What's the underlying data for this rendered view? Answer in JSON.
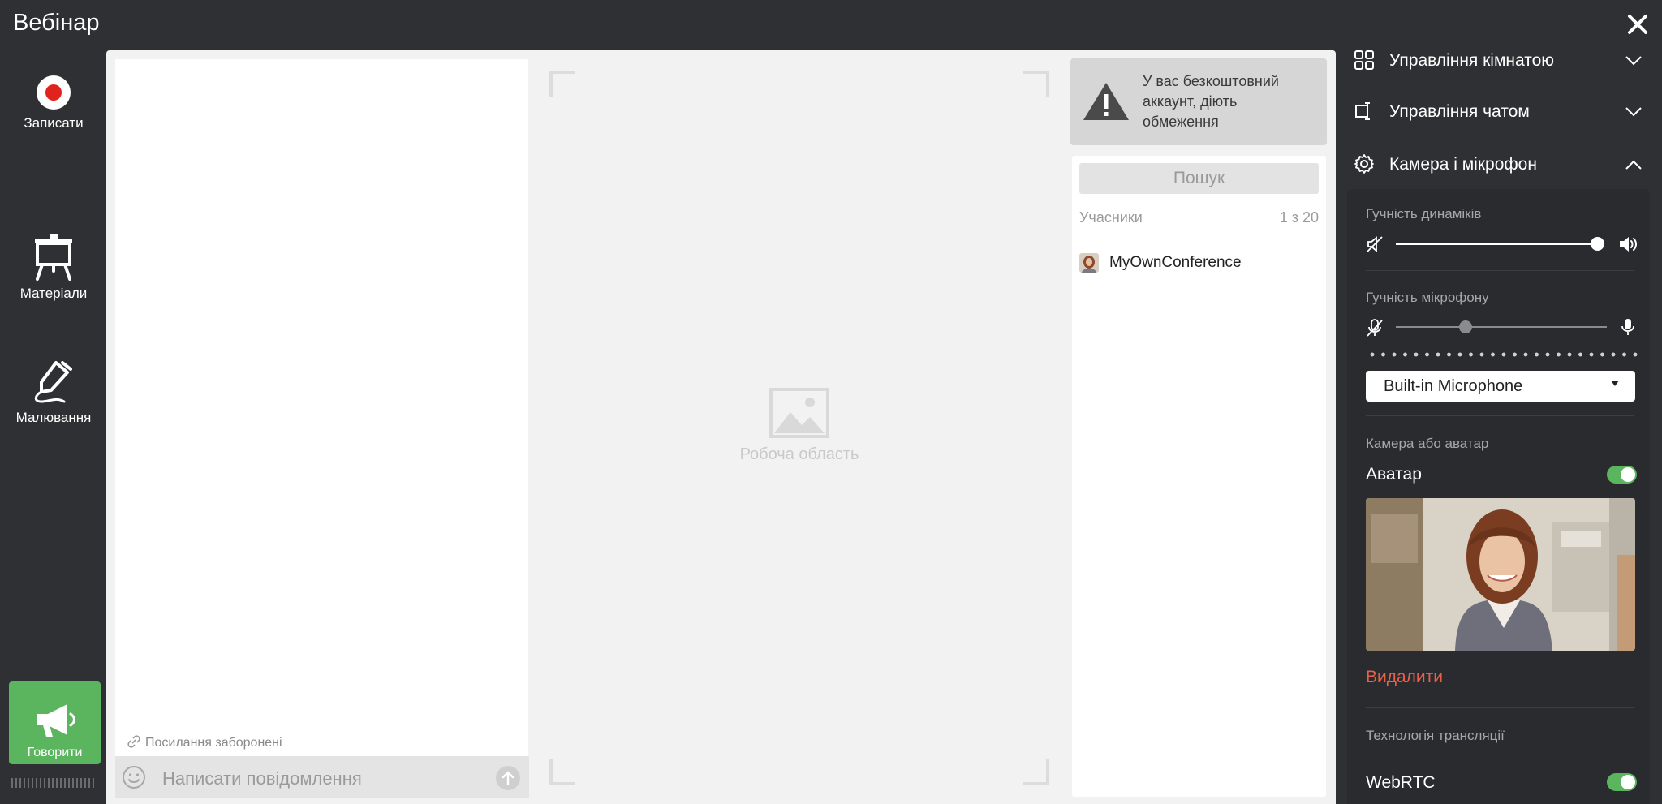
{
  "window": {
    "title": "Вебінар"
  },
  "sidebar": {
    "record_label": "Записати",
    "materials_label": "Матеріали",
    "drawing_label": "Малювання",
    "speak_label": "Говорити"
  },
  "chat": {
    "links_note": "Посилання заборонені",
    "input_placeholder": "Написати повідомлення"
  },
  "workspace": {
    "label": "Робоча область"
  },
  "warning": {
    "text": "У вас безкоштовний аккаунт, діють обмеження"
  },
  "participants": {
    "search_label": "Пошук",
    "header_label": "Учасники",
    "count": "1 з 20",
    "items": [
      {
        "name": "MyOwnConference"
      }
    ]
  },
  "settings": {
    "room_control": "Управління кімнатою",
    "chat_control": "Управління чатом",
    "camera_mic": "Камера і мікрофон",
    "speaker_volume_label": "Гучність динаміків",
    "speaker_volume": 1.0,
    "mic_volume_label": "Гучність мікрофону",
    "mic_volume": 0.33,
    "mic_device": "Built-in Microphone",
    "camera_or_avatar_label": "Камера або аватар",
    "avatar_label": "Аватар",
    "avatar_enabled": true,
    "delete_label": "Видалити",
    "broadcast_tech_label": "Технологія трансляції",
    "webrtc_label": "WebRTC",
    "webrtc_enabled": true
  },
  "colors": {
    "accent_green": "#5bb55f",
    "danger": "#e95f4a",
    "record_red": "#e0231d"
  }
}
